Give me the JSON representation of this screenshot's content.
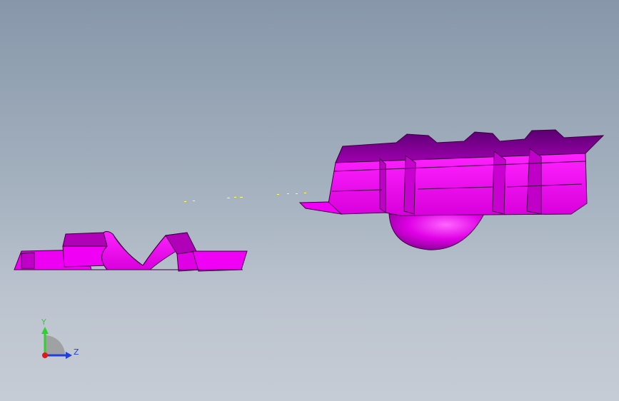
{
  "viewport": {
    "background_top": "#8797aa",
    "background_bottom": "#c6ccd5"
  },
  "model": {
    "part_color": "#ff00ff",
    "part_shade": "#b000b8",
    "edge_color": "#3a0040",
    "sketch_color": "#ffff66"
  },
  "triad": {
    "y_label": "Y",
    "z_label": "Z",
    "y_color": "#2fd12f",
    "z_color": "#1f3fe0",
    "x_color": "#e01818"
  }
}
